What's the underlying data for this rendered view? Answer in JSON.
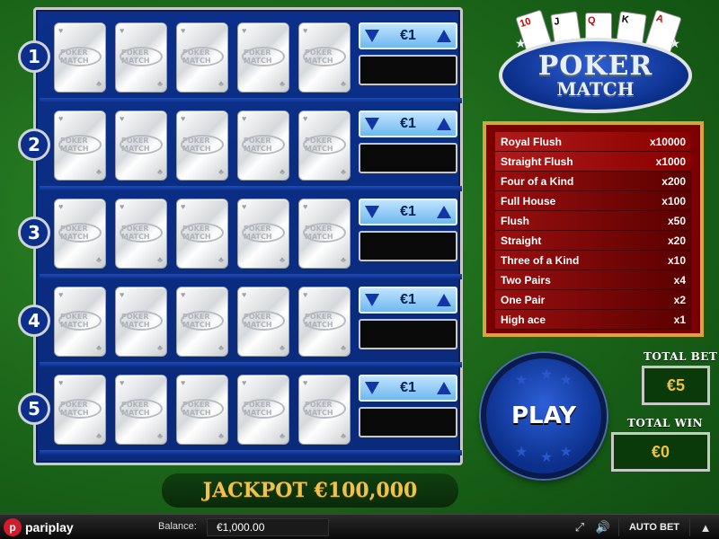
{
  "rows": [
    {
      "number": "1",
      "bet": "€1"
    },
    {
      "number": "2",
      "bet": "€1"
    },
    {
      "number": "3",
      "bet": "€1"
    },
    {
      "number": "4",
      "bet": "€1"
    },
    {
      "number": "5",
      "bet": "€1"
    }
  ],
  "card_back_label": "POKER MATCH",
  "logo": {
    "line1": "POKER",
    "line2": "MATCH",
    "cards": [
      "10",
      "J",
      "Q",
      "K",
      "A"
    ]
  },
  "paytable": [
    {
      "hand": "Royal Flush",
      "payout": "x10000"
    },
    {
      "hand": "Straight Flush",
      "payout": "x1000"
    },
    {
      "hand": "Four of a Kind",
      "payout": "x200"
    },
    {
      "hand": "Full House",
      "payout": "x100"
    },
    {
      "hand": "Flush",
      "payout": "x50"
    },
    {
      "hand": "Straight",
      "payout": "x20"
    },
    {
      "hand": "Three of a Kind",
      "payout": "x10"
    },
    {
      "hand": "Two Pairs",
      "payout": "x4"
    },
    {
      "hand": "One Pair",
      "payout": "x2"
    },
    {
      "hand": "High ace",
      "payout": "x1"
    }
  ],
  "play_label": "PLAY",
  "total_bet": {
    "label": "TOTAL BET",
    "value": "€5"
  },
  "total_win": {
    "label": "TOTAL WIN",
    "value": "€0"
  },
  "jackpot": "JACKPOT €100,000",
  "bottom": {
    "brand": "pariplay",
    "balance_label": "Balance:",
    "balance_value": "€1,000.00",
    "auto_bet": "AUTO BET"
  },
  "colors": {
    "board_blue": "#0b2f8a",
    "paytable_red": "#7a0000",
    "gold": "#f0c24a"
  }
}
